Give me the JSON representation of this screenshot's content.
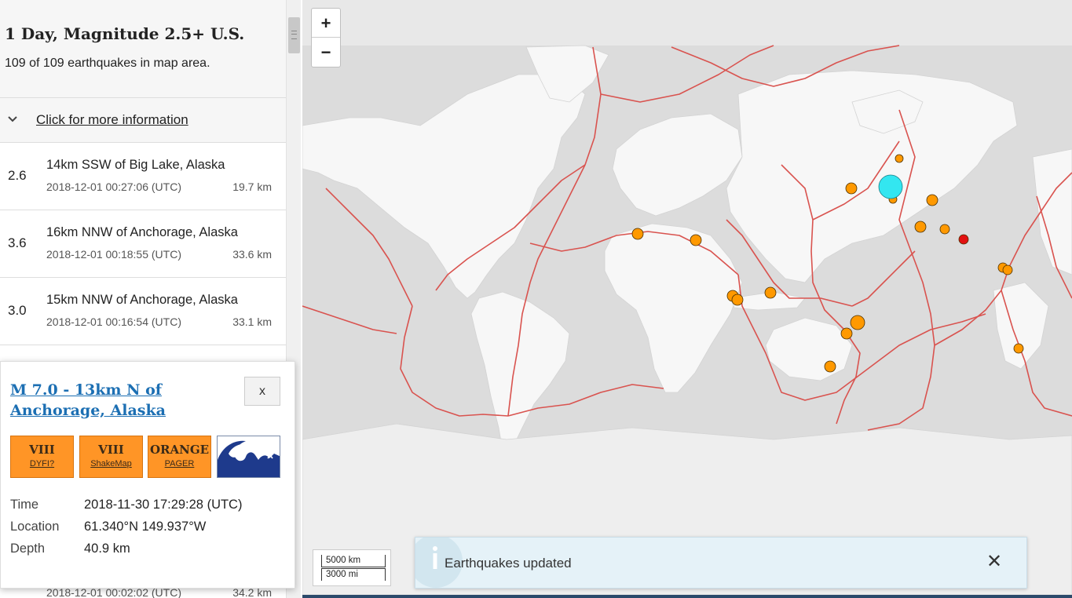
{
  "feed": {
    "title": "1 Day, Magnitude 2.5+ U.S.",
    "count_text": "109 of 109 earthquakes in map area.",
    "more_info": "Click for more information"
  },
  "earthquakes": [
    {
      "mag": "2.6",
      "place": "14km SSW of Big Lake, Alaska",
      "time": "2018-12-01 00:27:06 (UTC)",
      "depth": "19.7 km"
    },
    {
      "mag": "3.6",
      "place": "16km NNW of Anchorage, Alaska",
      "time": "2018-12-01 00:18:55 (UTC)",
      "depth": "33.6 km"
    },
    {
      "mag": "3.0",
      "place": "15km NNW of Anchorage, Alaska",
      "time": "2018-12-01 00:16:54 (UTC)",
      "depth": "33.1 km"
    },
    {
      "mag": "",
      "place": "",
      "time": "2018-12-01 00:02:02 (UTC)",
      "depth": "34.2 km"
    }
  ],
  "detail": {
    "title": "M 7.0 - 13km N of Anchorage, Alaska",
    "close": "x",
    "dyfi": {
      "level": "VIII",
      "label": "DYFI?"
    },
    "shakemap": {
      "level": "VIII",
      "label": "ShakeMap"
    },
    "pager": {
      "level": "ORANGE",
      "label": "PAGER"
    },
    "tsunami_icon": "tsunami-wave-icon",
    "time_label": "Time",
    "time_value": "2018-11-30 17:29:28 (UTC)",
    "location_label": "Location",
    "location_value": "61.340°N 149.937°W",
    "depth_label": "Depth",
    "depth_value": "40.9 km"
  },
  "map": {
    "zoom_in": "+",
    "zoom_out": "−",
    "scale_km": "5000 km",
    "scale_mi": "3000 mi",
    "plate_color": "#d9534f",
    "quake_color": "#ff9900",
    "highlight_color": "#33e6f0",
    "recent_color": "#e21111"
  },
  "toast": {
    "icon": "info-icon",
    "message": "Earthquakes updated",
    "close": "✕"
  }
}
